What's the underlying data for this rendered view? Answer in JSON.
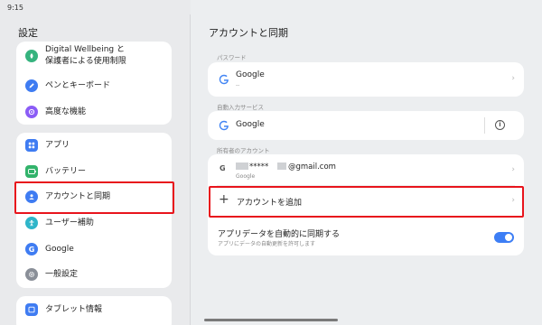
{
  "status": {
    "time": "9:15",
    "dots": "•••"
  },
  "sidebar": {
    "title": "設定",
    "items": [
      {
        "label_line1": "Digital Wellbeing と",
        "label_line2": "保護者による使用制限",
        "icon": "wellbeing-icon",
        "color": "#36b37e"
      },
      {
        "label": "ペンとキーボード",
        "icon": "pen-icon",
        "color": "#3f7cf2"
      },
      {
        "label": "高度な機能",
        "icon": "advanced-features-icon",
        "color": "#8b5cf6"
      },
      {
        "label": "アプリ",
        "icon": "apps-icon",
        "color": "#3f7cf2"
      },
      {
        "label": "バッテリー",
        "icon": "battery-icon",
        "color": "#32b36b"
      },
      {
        "label": "アカウントと同期",
        "icon": "account-icon",
        "color": "#3f7cf2",
        "selected": true
      },
      {
        "label": "ユーザー補助",
        "icon": "accessibility-icon",
        "color": "#2fb5c9"
      },
      {
        "label": "Google",
        "icon": "google-icon",
        "color": "#3f7cf2"
      },
      {
        "label": "一般設定",
        "icon": "general-settings-icon",
        "color": "#8a8f98"
      },
      {
        "label": "タブレット情報",
        "icon": "tablet-info-icon",
        "color": "#3f7cf2"
      }
    ]
  },
  "main": {
    "title": "アカウントと同期",
    "password_section": {
      "label": "パスワード",
      "item_title": "Google",
      "item_subtitle": "--"
    },
    "autofill_section": {
      "label": "自動入力サービス",
      "item_title": "Google"
    },
    "owner_section": {
      "label": "所有者のアカウント",
      "account_email_masked": "*****",
      "account_email_suffix": "@gmail.com",
      "account_provider": "Google",
      "add_account_label": "アカウントを追加"
    },
    "sync": {
      "title": "アプリデータを自動的に同期する",
      "subtitle": "アプリにデータの自動更新を許可します",
      "enabled": true
    }
  },
  "colors": {
    "accent": "#3d7ef5",
    "highlight": "#e8141c"
  }
}
